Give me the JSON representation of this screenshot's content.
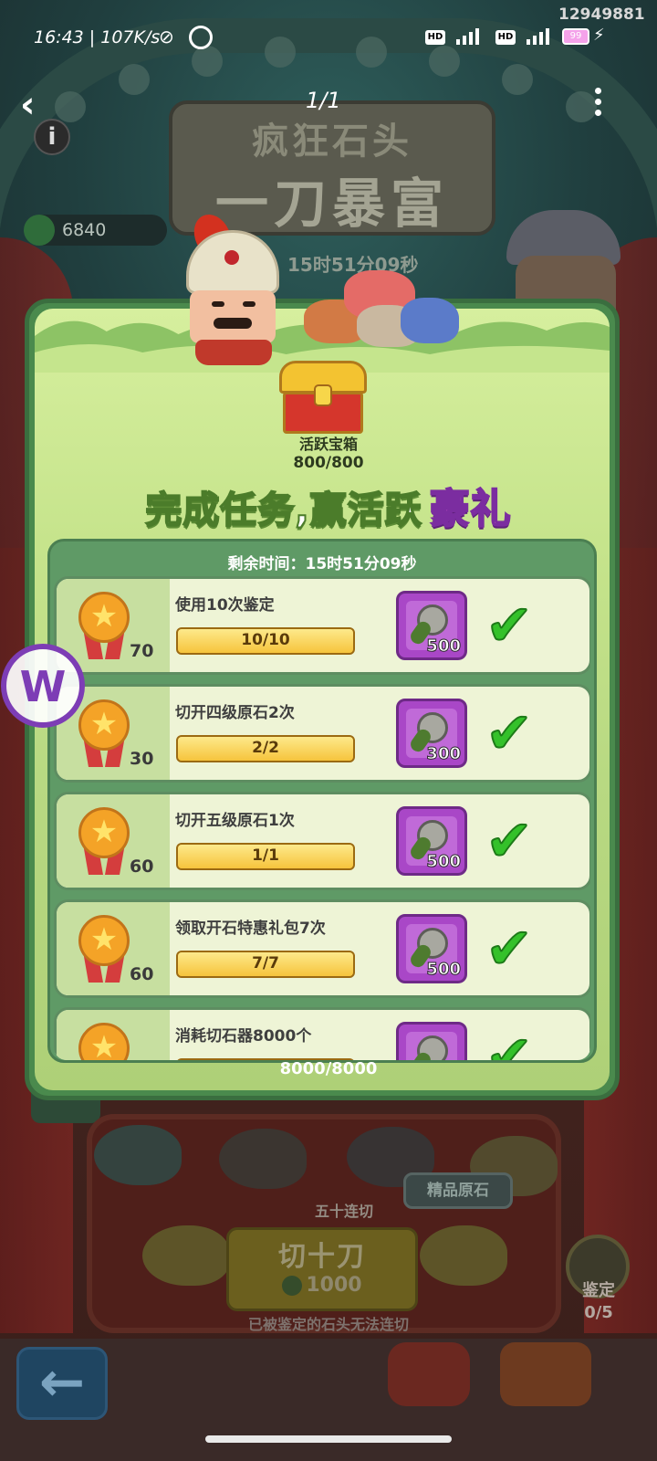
{
  "status_bar": {
    "time": "16:43",
    "speed": "107K/s",
    "battery": "99",
    "net1": "HD",
    "net2": "HD"
  },
  "overlay_id": "12949881",
  "viewer": {
    "page_indicator": "1/1"
  },
  "game": {
    "title_line1": "疯狂石头",
    "title_line2": "一刀暴富",
    "key_count": "6840",
    "timer_bg": "15时51分09秒",
    "premium_bubble": "精品原石",
    "fifty_label": "五十连切",
    "cut_button": {
      "label": "切十刀",
      "cost": "1000"
    },
    "hint": "已被鉴定的石头无法连切",
    "appraise": {
      "label": "鉴定",
      "count": "0/5"
    }
  },
  "modal": {
    "chest": {
      "label": "活跃宝箱",
      "count": "800/800"
    },
    "banner_main": "完成任务,赢活跃",
    "banner_highlight": "豪礼",
    "remaining_time": "剩余时间：15时51分09秒",
    "tasks": [
      {
        "title": "使用10次鉴定",
        "points": "70",
        "progress_text": "10/10",
        "progress": 1.0,
        "reward": "500",
        "done": true
      },
      {
        "title": "切开四级原石2次",
        "points": "30",
        "progress_text": "2/2",
        "progress": 1.0,
        "reward": "300",
        "done": true
      },
      {
        "title": "切开五级原石1次",
        "points": "60",
        "progress_text": "1/1",
        "progress": 1.0,
        "reward": "500",
        "done": true
      },
      {
        "title": "领取开石特惠礼包7次",
        "points": "60",
        "progress_text": "7/7",
        "progress": 1.0,
        "reward": "500",
        "done": true
      },
      {
        "title": "消耗切石器8000个",
        "points": "",
        "progress_text": "8000/8000",
        "progress": 1.0,
        "reward": "",
        "done": true
      }
    ]
  },
  "icons": {
    "back": "back-arrow-icon",
    "more": "more-vertical-icon",
    "info": "info-icon",
    "check": "check-icon",
    "medal": "star-medal-icon",
    "key": "key-icon"
  },
  "colors": {
    "panel_green": "#4a8a4d",
    "banner_pink": "#f15cdc",
    "check_green": "#34c12a",
    "reward_purple": "#a947c7",
    "progress_gold": "#f6c43c"
  }
}
